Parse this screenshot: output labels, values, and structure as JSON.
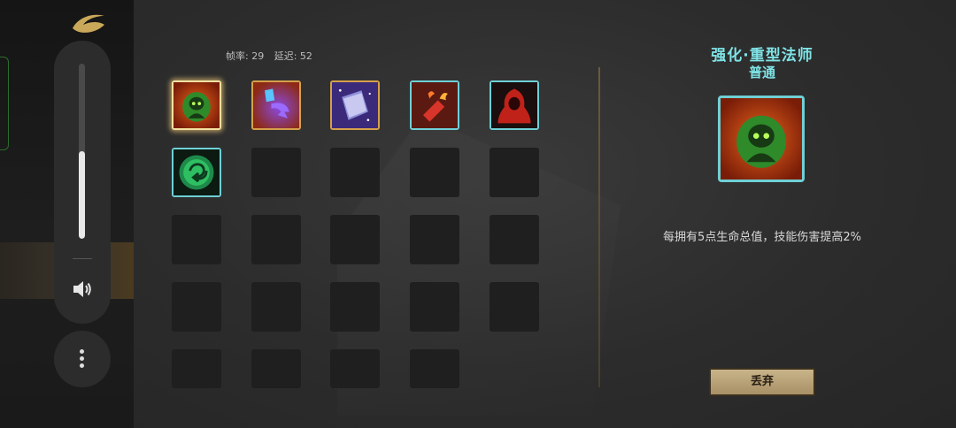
{
  "overlay": {
    "volume_level": 0.5,
    "icons": [
      "game-logo-icon",
      "volume-speaker-icon",
      "more-vertical-icon"
    ]
  },
  "stats": {
    "fps": "帧率: 29",
    "latency": "延迟: 52"
  },
  "inventory": {
    "items": [
      {
        "icon": "green-spirit-skull-icon",
        "border": "gold",
        "selected": true
      },
      {
        "icon": "purple-crystal-arrow-icon",
        "border": "gold",
        "selected": false
      },
      {
        "icon": "magic-spellbook-icon",
        "border": "gold",
        "selected": false
      },
      {
        "icon": "red-firecracker-icon",
        "border": "teal",
        "selected": false
      },
      {
        "icon": "red-hooded-figure-icon",
        "border": "teal",
        "selected": false
      },
      {
        "icon": "green-swirl-orb-icon",
        "border": "teal",
        "selected": false
      }
    ],
    "empty_slot_count": 18
  },
  "detail": {
    "title": "强化·重型法师",
    "rarity": "普通",
    "icon": "green-spirit-skull-icon",
    "description": "每拥有5点生命总值，技能伤害提高2%",
    "discard_label": "丢弃"
  },
  "colors": {
    "accent_teal": "#6fd0d6",
    "title_teal": "#7fe3e6",
    "gold_border": "#d6a04a",
    "button_bg": "#b9a276"
  }
}
